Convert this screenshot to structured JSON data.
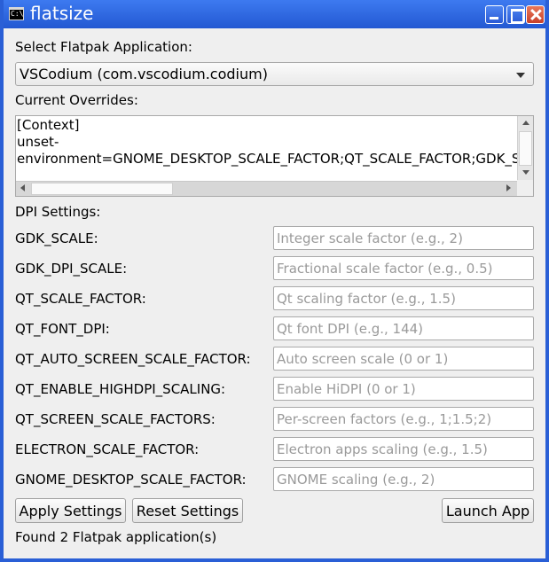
{
  "window": {
    "title": "flatsize",
    "icon_text": "C:\\"
  },
  "app_select": {
    "label": "Select Flatpak Application:",
    "selected": "VSCodium (com.vscodium.codium)"
  },
  "overrides": {
    "label": "Current Overrides:",
    "lines": [
      "[Context]",
      "unset-",
      "environment=GNOME_DESKTOP_SCALE_FACTOR;QT_SCALE_FACTOR;GDK_SCALE"
    ]
  },
  "dpi": {
    "label": "DPI Settings:",
    "fields": [
      {
        "label": "GDK_SCALE:",
        "placeholder": "Integer scale factor (e.g., 2)",
        "value": ""
      },
      {
        "label": "GDK_DPI_SCALE:",
        "placeholder": "Fractional scale factor (e.g., 0.5)",
        "value": ""
      },
      {
        "label": "QT_SCALE_FACTOR:",
        "placeholder": "Qt scaling factor (e.g., 1.5)",
        "value": ""
      },
      {
        "label": "QT_FONT_DPI:",
        "placeholder": "Qt font DPI (e.g., 144)",
        "value": ""
      },
      {
        "label": "QT_AUTO_SCREEN_SCALE_FACTOR:",
        "placeholder": "Auto screen scale (0 or 1)",
        "value": ""
      },
      {
        "label": "QT_ENABLE_HIGHDPI_SCALING:",
        "placeholder": "Enable HiDPI (0 or 1)",
        "value": ""
      },
      {
        "label": "QT_SCREEN_SCALE_FACTORS:",
        "placeholder": "Per-screen factors (e.g., 1;1.5;2)",
        "value": ""
      },
      {
        "label": "ELECTRON_SCALE_FACTOR:",
        "placeholder": "Electron apps scaling (e.g., 1.5)",
        "value": ""
      },
      {
        "label": "GNOME_DESKTOP_SCALE_FACTOR:",
        "placeholder": "GNOME scaling (e.g., 2)",
        "value": ""
      }
    ]
  },
  "buttons": {
    "apply": "Apply Settings",
    "reset": "Reset Settings",
    "launch": "Launch App"
  },
  "status": "Found 2 Flatpak application(s)",
  "icons": {
    "app": "terminal-icon",
    "minimize": "minimize-icon",
    "maximize": "maximize-icon",
    "close": "close-icon",
    "dropdown": "chevron-down-icon"
  },
  "colors": {
    "titlebar": "#2a5fd6",
    "close_button": "#c8402a",
    "placeholder": "#9a9a9a"
  }
}
